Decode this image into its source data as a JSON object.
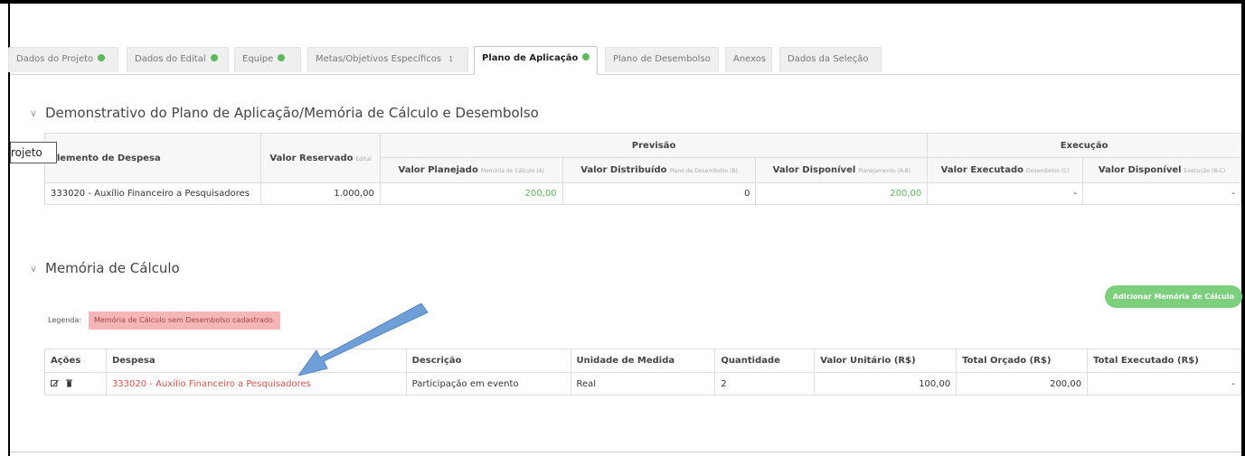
{
  "tabs": [
    {
      "label": "Dados do Projeto",
      "check": true
    },
    {
      "label": "Dados do Edital",
      "check": true
    },
    {
      "label": "Equipe",
      "check": true
    },
    {
      "label": "Metas/Objetivos Específicos",
      "count": "1"
    },
    {
      "label": "Plano de Aplicação",
      "check": true,
      "active": true
    },
    {
      "label": "Plano de Desembolso"
    },
    {
      "label": "Anexos"
    },
    {
      "label": "Dados da Seleção"
    }
  ],
  "demonstrativo": {
    "title": "Demonstrativo do Plano de Aplicação/Memória de Cálculo e Desembolso",
    "tooltip": "rojeto",
    "headers": {
      "elemento": "Elemento de Despesa",
      "valor_reservado": "Valor Reservado",
      "valor_reservado_sub": "Edital",
      "previsao": "Previsão",
      "execucao": "Execução",
      "valor_planejado": "Valor Planejado",
      "valor_planejado_sub": "Memória de Cálculo (A)",
      "valor_distribuido": "Valor Distribuído",
      "valor_distribuido_sub": "Plano de Desembolso (B)",
      "valor_disponivel_prev": "Valor Disponível",
      "valor_disponivel_prev_sub": "Planejamento (A-B)",
      "valor_executado": "Valor Executado",
      "valor_executado_sub": "Desembolso (C)",
      "valor_disponivel_exec": "Valor Disponível",
      "valor_disponivel_exec_sub": "Execução (B-C)"
    },
    "row": {
      "elemento": "333020 - Auxílio Financeiro a Pesquisadores",
      "valor_reservado": "1.000,00",
      "valor_planejado": "200,00",
      "valor_distribuido": "0",
      "valor_disponivel_prev": "200,00",
      "valor_executado": "-",
      "valor_disponivel_exec": "-"
    }
  },
  "memoria": {
    "title": "Memória de Cálculo",
    "add_button": "Adicionar Memória de Cálculo",
    "legend_label": "Legenda:",
    "legend_badge": "Memória de Cálculo sem Desembolso cadastrado.",
    "headers": {
      "acoes": "Ações",
      "despesa": "Despesa",
      "descricao": "Descrição",
      "unidade": "Unidade de Medida",
      "quantidade": "Quantidade",
      "valor_unitario": "Valor Unitário (R$)",
      "total_orcado": "Total Orçado (R$)",
      "total_executado": "Total Executado (R$)"
    },
    "row": {
      "despesa": "333020 - Auxílio Financeiro a Pesquisadores",
      "descricao": "Participação em evento",
      "unidade": "Real",
      "quantidade": "2",
      "valor_unitario": "100,00",
      "total_orcado": "200,00",
      "total_executado": "-"
    }
  },
  "colors": {
    "success": "#5cb85c",
    "danger_text": "#d9534f",
    "legend_bg": "#f4b6b6",
    "add_button_bg": "#7ccf7c",
    "arrow": "#6f9fd8"
  },
  "icons": [
    "check-icon",
    "chevron-down-icon",
    "edit-icon",
    "trash-icon",
    "arrow-annotation"
  ]
}
